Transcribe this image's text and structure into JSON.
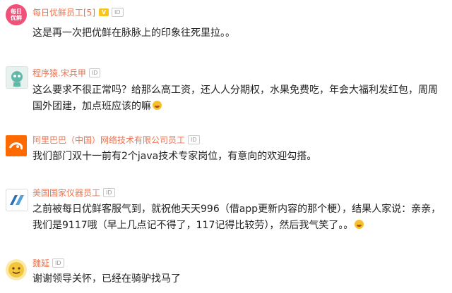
{
  "comments": [
    {
      "username": "每日优鲜员工[5]",
      "badge": "ID",
      "avatar_text": [
        "每日",
        "优鲜"
      ],
      "text": "这是再一次把优鲜在脉脉上的印象往死里拉。。"
    },
    {
      "username": "程序猿.宋兵甲",
      "badge": "ID",
      "text": "这么要求不很正常吗？给那么高工资，还人人分期权，水果免费吃，年会大福利发红包，周周国外团建，加点班应该的嘛"
    },
    {
      "username": "阿里巴巴（中国）网络技术有限公司员工",
      "badge": "ID",
      "text": "我们部门双十一前有2个java技术专家岗位，有意向的欢迎勾搭。"
    },
    {
      "username": "美国国家仪器员工",
      "badge": "ID",
      "text": "之前被每日优鲜客服气到，就祝他天天996（借app更新内容的那个梗），结果人家说：亲亲，我们是9117哦（早上几点记不得了，117记得比较劳），然后我气笑了。。"
    },
    {
      "username": "魏延",
      "badge": "ID",
      "text": "谢谢领导关怀，已经在骑驴找马了"
    }
  ],
  "vip_label": "V",
  "colors": {
    "username": "#eb7350",
    "vip": "#f7c51e",
    "text": "#222222"
  }
}
